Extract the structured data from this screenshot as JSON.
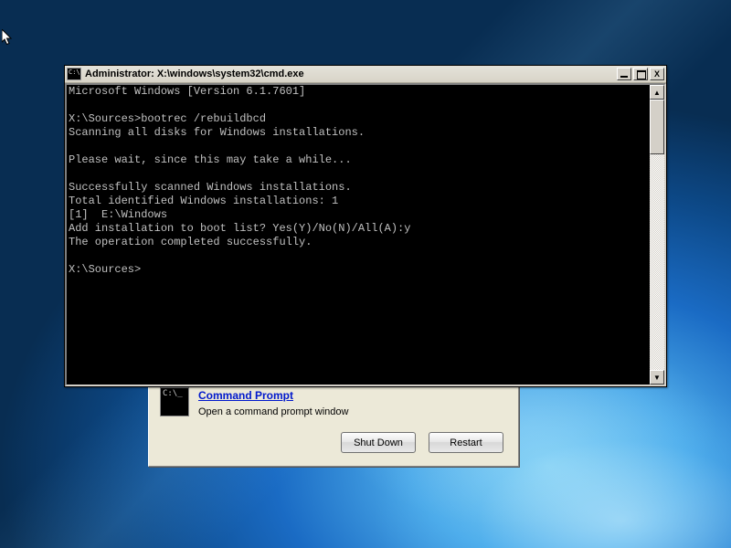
{
  "titlebar": {
    "title": "Administrator: X:\\windows\\system32\\cmd.exe"
  },
  "terminal": {
    "lines": [
      "Microsoft Windows [Version 6.1.7601]",
      "",
      "X:\\Sources>bootrec /rebuildbcd",
      "Scanning all disks for Windows installations.",
      "",
      "Please wait, since this may take a while...",
      "",
      "Successfully scanned Windows installations.",
      "Total identified Windows installations: 1",
      "[1]  E:\\Windows",
      "Add installation to boot list? Yes(Y)/No(N)/All(A):y",
      "The operation completed successfully.",
      "",
      "X:\\Sources>"
    ]
  },
  "recovery": {
    "link_label": "Command Prompt",
    "description": "Open a command prompt window",
    "shutdown_label": "Shut Down",
    "restart_label": "Restart",
    "icon_text": "C:\\_"
  },
  "window_controls": {
    "close": "X"
  }
}
